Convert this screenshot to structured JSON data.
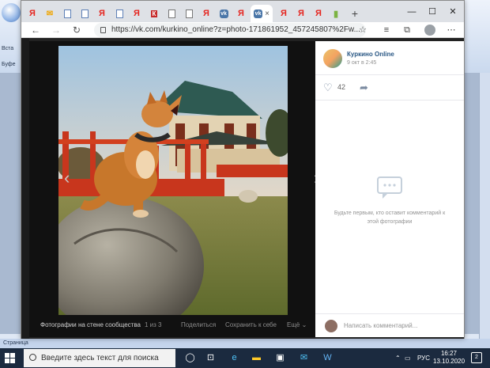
{
  "background_app": {
    "side_labels": [
      "Вста",
      "Буфе"
    ],
    "status_text": "Страница"
  },
  "browser": {
    "tabs": [
      {
        "icon": "yandex-icon",
        "glyph": "Я"
      },
      {
        "icon": "mail-icon",
        "glyph": "✉"
      },
      {
        "icon": "doc-icon",
        "glyph": ""
      },
      {
        "icon": "doc-icon",
        "glyph": ""
      },
      {
        "icon": "yandex-icon",
        "glyph": "Я"
      },
      {
        "icon": "doc-icon",
        "glyph": ""
      },
      {
        "icon": "yandex-icon",
        "glyph": "Я"
      },
      {
        "icon": "kino-icon",
        "glyph": "К"
      },
      {
        "icon": "doc-icon",
        "glyph": ""
      },
      {
        "icon": "doc-icon",
        "glyph": ""
      },
      {
        "icon": "yandex-icon",
        "glyph": "Я"
      },
      {
        "icon": "vk-icon",
        "glyph": "vk"
      },
      {
        "icon": "yandex-icon",
        "glyph": "Я"
      },
      {
        "icon": "vk-icon",
        "glyph": "vk",
        "active": true
      },
      {
        "icon": "yandex-icon",
        "glyph": "Я"
      },
      {
        "icon": "yandex-icon",
        "glyph": "Я"
      },
      {
        "icon": "yandex-icon",
        "glyph": "Я"
      },
      {
        "icon": "app-icon",
        "glyph": "▮"
      }
    ],
    "new_tab_glyph": "+",
    "close_tab_glyph": "×",
    "window_controls": {
      "minimize": "—",
      "maximize": "☐",
      "close": "✕"
    },
    "url": "https://vk.com/kurkino_online?z=photo-171861952_457245807%2Fw...",
    "nav": {
      "back": "←",
      "forward": "→",
      "reload": "↻"
    },
    "star_glyph": "☆"
  },
  "viewer": {
    "prev_glyph": "‹",
    "next_glyph": "›",
    "album": "Фотографии на стене сообщества",
    "counter": "1 из 3",
    "share": "Поделиться",
    "save": "Сохранить к себе",
    "more": "Ещё ⌄"
  },
  "post": {
    "group_name": "Куркино Online",
    "date": "9 окт в 2:45",
    "likes": "42",
    "empty_comments": "Будьте первым, кто оставит комментарий к этой фотографии",
    "write_placeholder": "Написать комментарий..."
  },
  "taskbar": {
    "search_placeholder": "Введите здесь текст для поиска",
    "lang": "РУС",
    "time": "16:27",
    "date": "13.10.2020",
    "notifications": "2"
  },
  "colors": {
    "vk_blue": "#4a76a8",
    "yandex_red": "#e52620",
    "taskbar": "#1b2a3f"
  }
}
